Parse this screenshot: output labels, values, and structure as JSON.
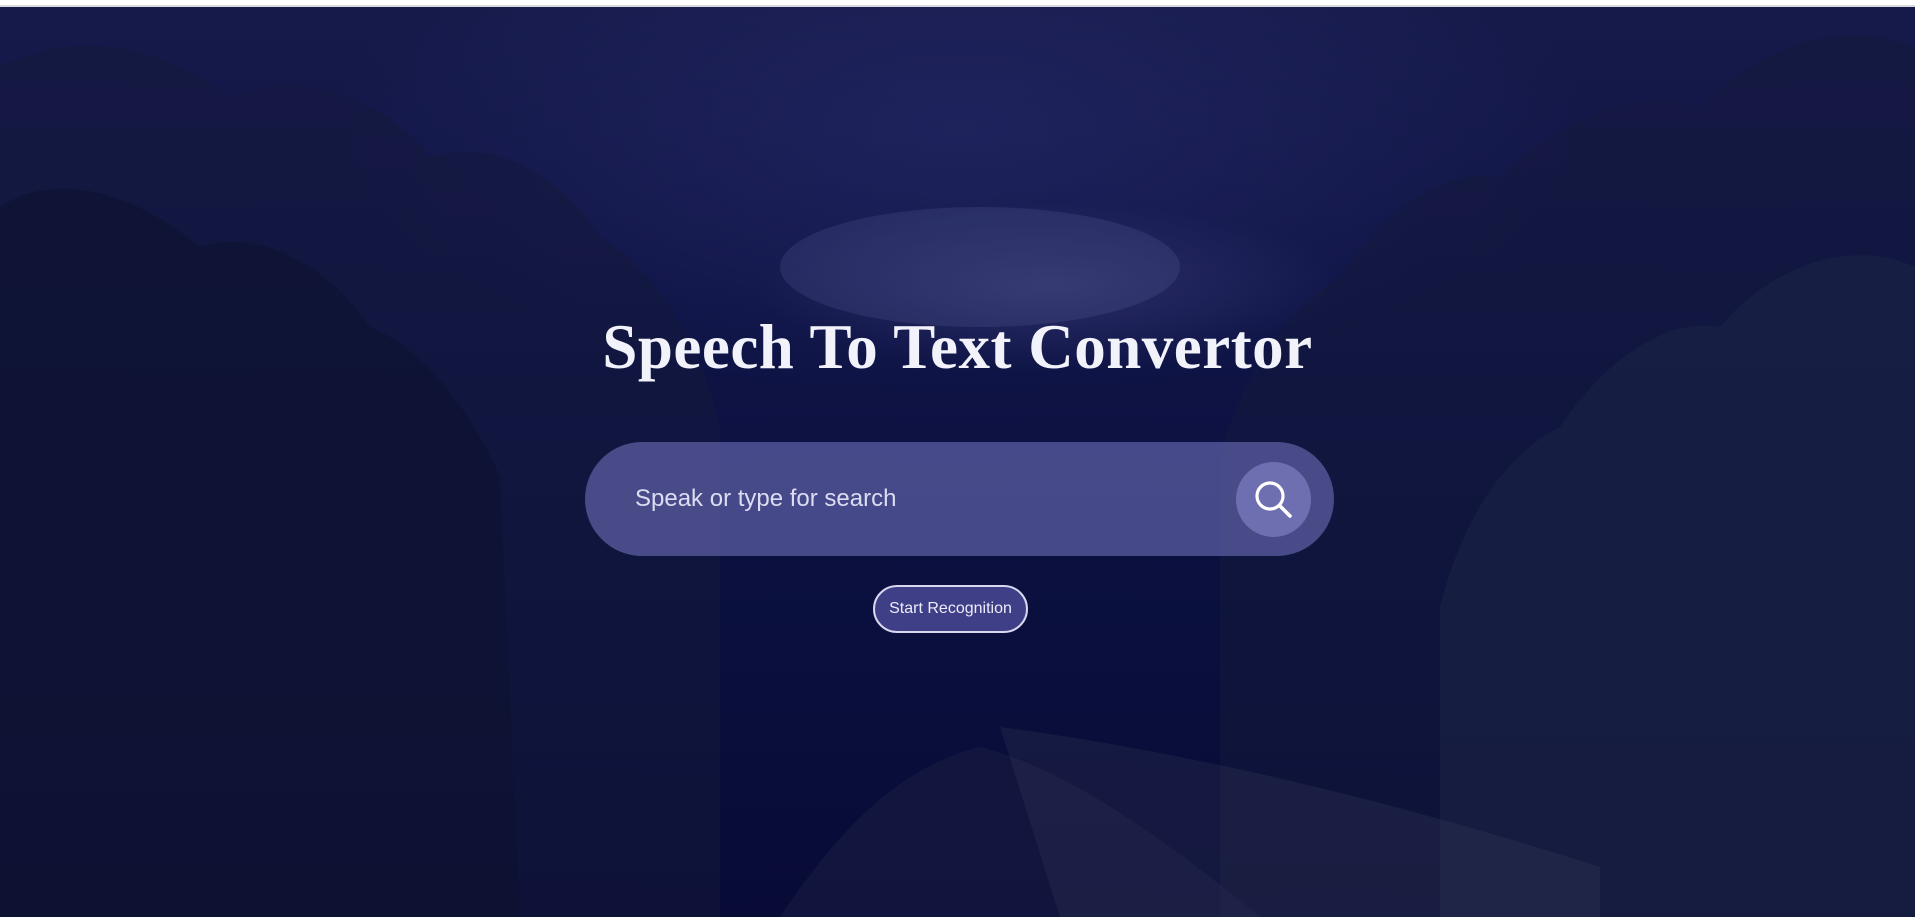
{
  "page": {
    "title": "Speech To Text Convertor"
  },
  "search": {
    "placeholder": "Speak or type for search",
    "value": "",
    "button_icon": "search-icon"
  },
  "recognition": {
    "button_label": "Start Recognition"
  },
  "colors": {
    "overlay": "#0a0f3d",
    "title_text": "#f2f2fa",
    "search_bar": "#6e70c0",
    "button_border": "#d8d8ee"
  }
}
